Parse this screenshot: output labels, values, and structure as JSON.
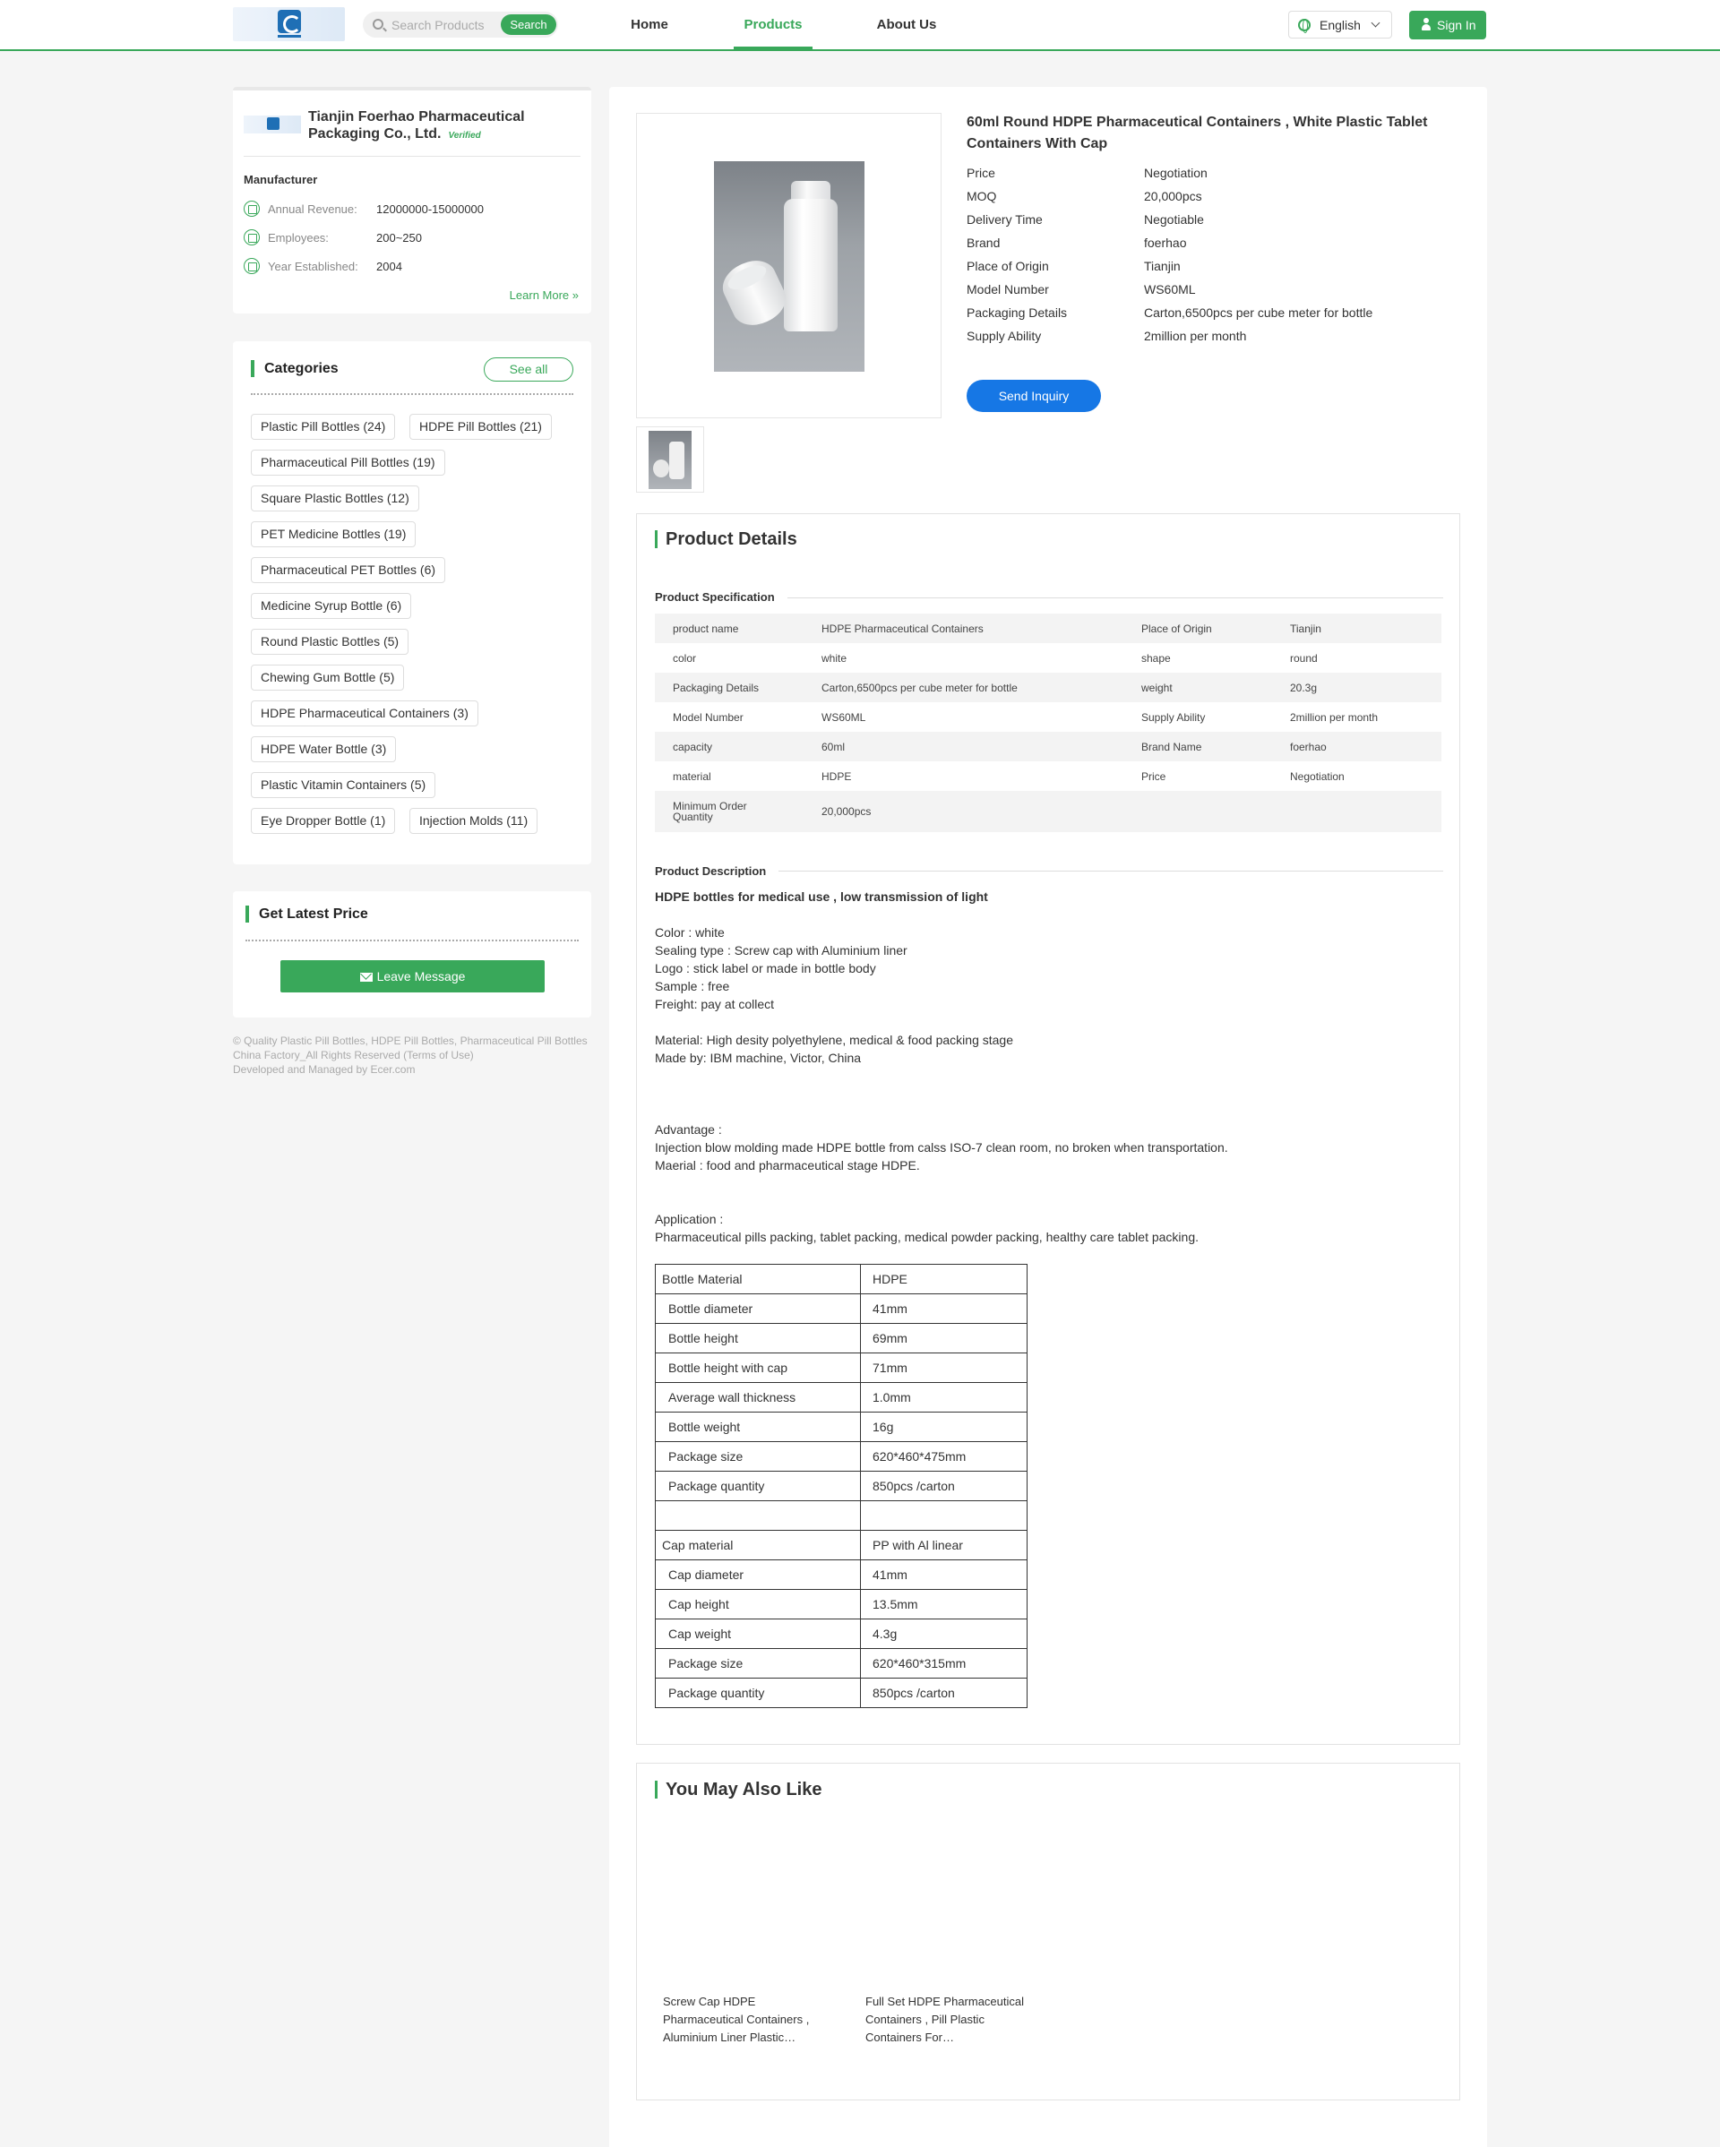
{
  "header": {
    "search_placeholder": "Search Products",
    "search_button": "Search",
    "nav": [
      "Home",
      "Products",
      "About Us"
    ],
    "language": "English",
    "signin": "Sign In"
  },
  "company": {
    "name": "Tianjin Foerhao Pharmaceutical Packaging Co., Ltd.",
    "verified": "Verified",
    "type": "Manufacturer",
    "info": [
      {
        "label": "Annual Revenue:",
        "value": "12000000-15000000"
      },
      {
        "label": "Employees:",
        "value": "200~250"
      },
      {
        "label": "Year Established:",
        "value": "2004"
      }
    ],
    "learn_more": "Learn More »"
  },
  "categories": {
    "title": "Categories",
    "see_all": "See all",
    "items": [
      "Plastic Pill Bottles  (24)",
      "HDPE Pill Bottles  (21)",
      "Pharmaceutical Pill Bottles  (19)",
      "Square Plastic Bottles  (12)",
      "PET Medicine Bottles  (19)",
      "Pharmaceutical PET Bottles  (6)",
      "Medicine Syrup Bottle  (6)",
      "Round Plastic Bottles  (5)",
      "Chewing Gum Bottle  (5)",
      "HDPE Pharmaceutical Containers  (3)",
      "HDPE Water Bottle  (3)",
      "Plastic Vitamin Containers  (5)",
      "Eye Dropper Bottle  (1)",
      "Injection Molds  (11)"
    ]
  },
  "latest_price": {
    "title": "Get Latest Price",
    "button": "Leave Message"
  },
  "footer": {
    "line1": "© Quality Plastic Pill Bottles, HDPE Pill Bottles, Pharmaceutical Pill Bottles China Factory_All Rights Reserved (Terms of Use)",
    "line2": "Developed and Managed by Ecer.com"
  },
  "product": {
    "title": "60ml Round HDPE Pharmaceutical Containers , White Plastic Tablet Containers With Cap",
    "attributes": [
      {
        "label": "Price",
        "value": "Negotiation"
      },
      {
        "label": "MOQ",
        "value": "20,000pcs"
      },
      {
        "label": "Delivery Time",
        "value": "Negotiable"
      },
      {
        "label": "Brand",
        "value": "foerhao"
      },
      {
        "label": "Place of Origin",
        "value": "Tianjin"
      },
      {
        "label": "Model Number",
        "value": "WS60ML"
      },
      {
        "label": "Packaging Details",
        "value": "Carton,6500pcs per cube meter for bottle"
      },
      {
        "label": "Supply Ability",
        "value": "2million per month"
      }
    ],
    "send_inquiry": "Send Inquiry"
  },
  "details": {
    "title": "Product Details",
    "spec_heading": "Product Specification",
    "spec_rows": [
      [
        "product name",
        "HDPE Pharmaceutical Containers",
        "Place of Origin",
        "Tianjin"
      ],
      [
        "color",
        "white",
        "shape",
        "round"
      ],
      [
        "Packaging Details",
        "Carton,6500pcs per cube meter for bottle",
        "weight",
        "20.3g"
      ],
      [
        "Model Number",
        "WS60ML",
        "Supply Ability",
        "2million per month"
      ],
      [
        "capacity",
        "60ml",
        "Brand Name",
        "foerhao"
      ],
      [
        "material",
        "HDPE",
        "Price",
        "Negotiation"
      ],
      [
        "Minimum Order Quantity",
        "20,000pcs",
        "",
        ""
      ]
    ],
    "desc_heading": "Product Description",
    "desc_bold": "HDPE bottles for medical use , low transmission of light",
    "desc_lines": [
      "Color : white",
      "Sealing type : Screw cap with Aluminium liner",
      "Logo : stick label or made in bottle body",
      "Sample : free",
      "Freight: pay at collect",
      "Material: High desity polyethylene, medical & food packing stage",
      "Made by: IBM machine, Victor, China",
      "Advantage :",
      "Injection blow molding made HDPE bottle from calss ISO-7 clean room, no broken when transportation.",
      "Maerial : food and pharmaceutical stage HDPE.",
      "Application :",
      "Pharmaceutical pills packing, tablet packing, medical powder packing, healthy care tablet packing."
    ],
    "dim_rows": [
      [
        "Bottle Material",
        "HDPE"
      ],
      [
        "Bottle diameter",
        "41mm"
      ],
      [
        "Bottle height",
        "69mm"
      ],
      [
        "Bottle height with cap",
        "71mm"
      ],
      [
        "Average wall thickness",
        "1.0mm"
      ],
      [
        "Bottle weight",
        "16g"
      ],
      [
        "Package size",
        "620*460*475mm"
      ],
      [
        "Package quantity",
        "850pcs /carton"
      ],
      [
        "",
        ""
      ],
      [
        "Cap material",
        "PP with Al linear"
      ],
      [
        "Cap diameter",
        "41mm"
      ],
      [
        "Cap height",
        "13.5mm"
      ],
      [
        "Cap weight",
        "4.3g"
      ],
      [
        "Package size",
        "620*460*315mm"
      ],
      [
        "Package quantity",
        "850pcs /carton"
      ]
    ]
  },
  "also_like": {
    "title": "You May Also Like",
    "items": [
      "Screw Cap HDPE Pharmaceutical Containers , Aluminium Liner Plastic…",
      "Full Set HDPE Pharmaceutical Containers , Pill Plastic Containers For…"
    ]
  },
  "colors": {
    "accent": "#39a85a",
    "inquiry": "#1677e5"
  }
}
